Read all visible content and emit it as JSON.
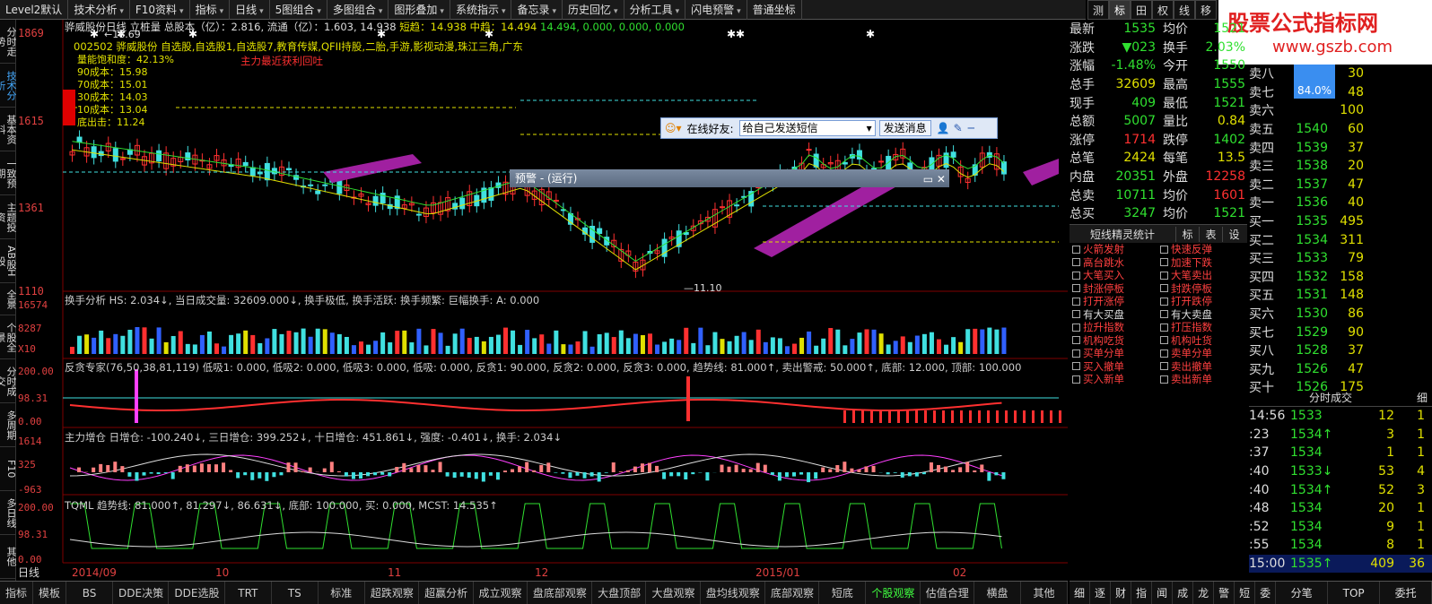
{
  "toolbar": {
    "items": [
      "Level2默认",
      "技术分析",
      "F10资料",
      "指标",
      "日线",
      "5图组合",
      "多图组合",
      "图形叠加",
      "系统指示",
      "备忘录",
      "历史回忆",
      "分析工具",
      "闪电预警",
      "普通坐标"
    ]
  },
  "right_tabs": [
    "测",
    "标",
    "田",
    "权",
    "线",
    "移"
  ],
  "watermark": {
    "title": "股票公式指标网",
    "url": "www.gszb.com"
  },
  "left_tabs": [
    "分时走势",
    "技术分析",
    "基本资料",
    "一致预期",
    "主题投资",
    "AB股H股",
    "全景",
    "个股全景",
    "分时成交",
    "多周期",
    "F10",
    "多日线",
    "其他"
  ],
  "main_chart": {
    "stock_name": "骅威股份日线",
    "indicator": "立桩量",
    "info": "总股本（亿）：2.816, 流通（亿）：1.603, 14.938",
    "short": "短趋：14.938",
    "mid": "中趋：14.494",
    "values": "14.494, 0.000, 0.000, 0.000",
    "concepts": "002502 骅威股份 自选股,自选股1,自选股7,教育传媒,QFII持股,二胎,手游,影视动漫,珠江三角,广东",
    "alert": "主力最近获利回吐",
    "cost_lines": [
      "量能饱和度：42.13%",
      "90成本：15.98",
      "70成本：15.01",
      "30成本：14.03",
      "10成本：13.04",
      "底出击：11.24"
    ],
    "y_ticks": [
      "1869",
      "1615",
      "1361",
      "1110"
    ],
    "high_label": "18.69",
    "low_label": "11.10"
  },
  "panels": {
    "turnover": {
      "head": "换手分析 HS: 2.034↓, 当日成交量: 32609.000↓, 换手极低, 换手活跃: 换手频繁: 巨幅换手: A: 0.000",
      "ticks": [
        "16574",
        "8287",
        "X10"
      ]
    },
    "fantan": {
      "head": "反贪专家(76,50,38,81,119) 低吸1: 0.000, 低吸2: 0.000, 低吸3: 0.000, 低吸: 0.000, 反贪1: 90.000, 反贪2: 0.000, 反贪3: 0.000, 趋势线: 81.000↑, 卖出警戒: 50.000↑, 底部: 12.000, 顶部: 100.000",
      "ticks": [
        "200.00",
        "98.31",
        "0.00"
      ]
    },
    "zhuli": {
      "head": "主力增仓 日增仓: -100.240↓, 三日增仓: 399.252↓, 十日增仓: 451.861↓, 强度: -0.401↓, 换手: 2.034↓",
      "ticks": [
        "1614",
        "325",
        "-963"
      ]
    },
    "tqml": {
      "head": "TQML 趋势线: 81.000↑, 81.297↓, 86.631↓, 底部: 100.000, 买: 0.000, MCST: 14.535↑",
      "ticks": [
        "200.00",
        "98.31",
        "0.00"
      ]
    }
  },
  "x_axis": [
    "日线",
    "2014/09",
    "10",
    "11",
    "12",
    "2015/01",
    "02"
  ],
  "bottom_tabs": [
    "指标",
    "模板",
    "BS",
    "DDE决策",
    "DDE选股",
    "TRT",
    "TS",
    "标准",
    "超跌观察",
    "超赢分析",
    "成立观察",
    "盘底部观察",
    "大盘顶部",
    "大盘观察",
    "盘均线观察",
    "底部观察",
    "短底",
    "个股观察",
    "估值合理",
    "横盘",
    "其他"
  ],
  "quote": {
    "rows": [
      [
        "最新",
        "1535",
        "均价",
        "1521"
      ],
      [
        "涨跌",
        "▼023",
        "换手",
        "2.03%"
      ],
      [
        "涨幅",
        "-1.48%",
        "今开",
        "1550"
      ],
      [
        "总手",
        "32609",
        "最高",
        "1555"
      ],
      [
        "现手",
        "409",
        "最低",
        "1521"
      ],
      [
        "总额",
        "5007",
        "量比",
        "0.84"
      ],
      [
        "涨停",
        "1714",
        "跌停",
        "1402"
      ],
      [
        "总笔",
        "2424",
        "每笔",
        "13.5"
      ],
      [
        "内盘",
        "20351",
        "外盘",
        "12258"
      ],
      [
        "总卖",
        "10711",
        "均价",
        "1601"
      ],
      [
        "总买",
        "3247",
        "均价",
        "1521"
      ]
    ]
  },
  "book": {
    "pct": "84.0%",
    "asks": [
      [
        "卖八",
        "",
        "30"
      ],
      [
        "卖七",
        "",
        "48"
      ],
      [
        "卖六",
        "",
        "100"
      ],
      [
        "卖五",
        "1540",
        "60"
      ],
      [
        "卖四",
        "1539",
        "37"
      ],
      [
        "卖三",
        "1538",
        "20"
      ],
      [
        "卖二",
        "1537",
        "47"
      ],
      [
        "卖一",
        "1536",
        "40"
      ]
    ],
    "bids": [
      [
        "买一",
        "1535",
        "495"
      ],
      [
        "买二",
        "1534",
        "311"
      ],
      [
        "买三",
        "1533",
        "79"
      ],
      [
        "买四",
        "1532",
        "158"
      ],
      [
        "买五",
        "1531",
        "148"
      ],
      [
        "买六",
        "1530",
        "86"
      ],
      [
        "买七",
        "1529",
        "90"
      ],
      [
        "买八",
        "1528",
        "37"
      ],
      [
        "买九",
        "1526",
        "47"
      ],
      [
        "买十",
        "1526",
        "175"
      ]
    ]
  },
  "sprite": {
    "title": "短线精灵统计",
    "tabs": [
      "标",
      "表",
      "设"
    ],
    "items": [
      "火箭发射",
      "快速反弹",
      "高台跳水",
      "加速下跌",
      "大笔买入",
      "大笔卖出",
      "封涨停板",
      "封跌停板",
      "打开涨停",
      "打开跌停",
      "有大买盘",
      "有大卖盘",
      "拉升指数",
      "打压指数",
      "机构吃货",
      "机构吐货",
      "买单分单",
      "卖单分单",
      "买入撤单",
      "卖出撤单",
      "买入新单",
      "卖出新单"
    ]
  },
  "ts": {
    "title": "分时成交",
    "tab": "细",
    "rows": [
      [
        "14:56",
        "1533",
        "12",
        "1"
      ],
      [
        ":23",
        "1534↑",
        "3",
        "1"
      ],
      [
        ":37",
        "1534",
        "1",
        "1"
      ],
      [
        ":40",
        "1533↓",
        "53",
        "4"
      ],
      [
        ":40",
        "1534↑",
        "52",
        "3"
      ],
      [
        ":48",
        "1534",
        "20",
        "1"
      ],
      [
        ":52",
        "1534",
        "9",
        "1"
      ],
      [
        ":55",
        "1534",
        "8",
        "1"
      ],
      [
        "15:00",
        "1535↑",
        "409",
        "36"
      ]
    ]
  },
  "right_bottom_tabs": [
    "细",
    "逐",
    "财",
    "指",
    "闻",
    "成",
    "龙",
    "警",
    "短",
    "委",
    "分笔",
    "TOP",
    "委托"
  ],
  "chat": {
    "label": "在线好友:",
    "select": "给自己发送短信",
    "send": "发送消息"
  },
  "warn": {
    "title": "预警 - (运行)"
  },
  "colors": {
    "up": "#ff3030",
    "down": "#40e0e0",
    "bg": "#000000",
    "accent": "#e0e000"
  }
}
